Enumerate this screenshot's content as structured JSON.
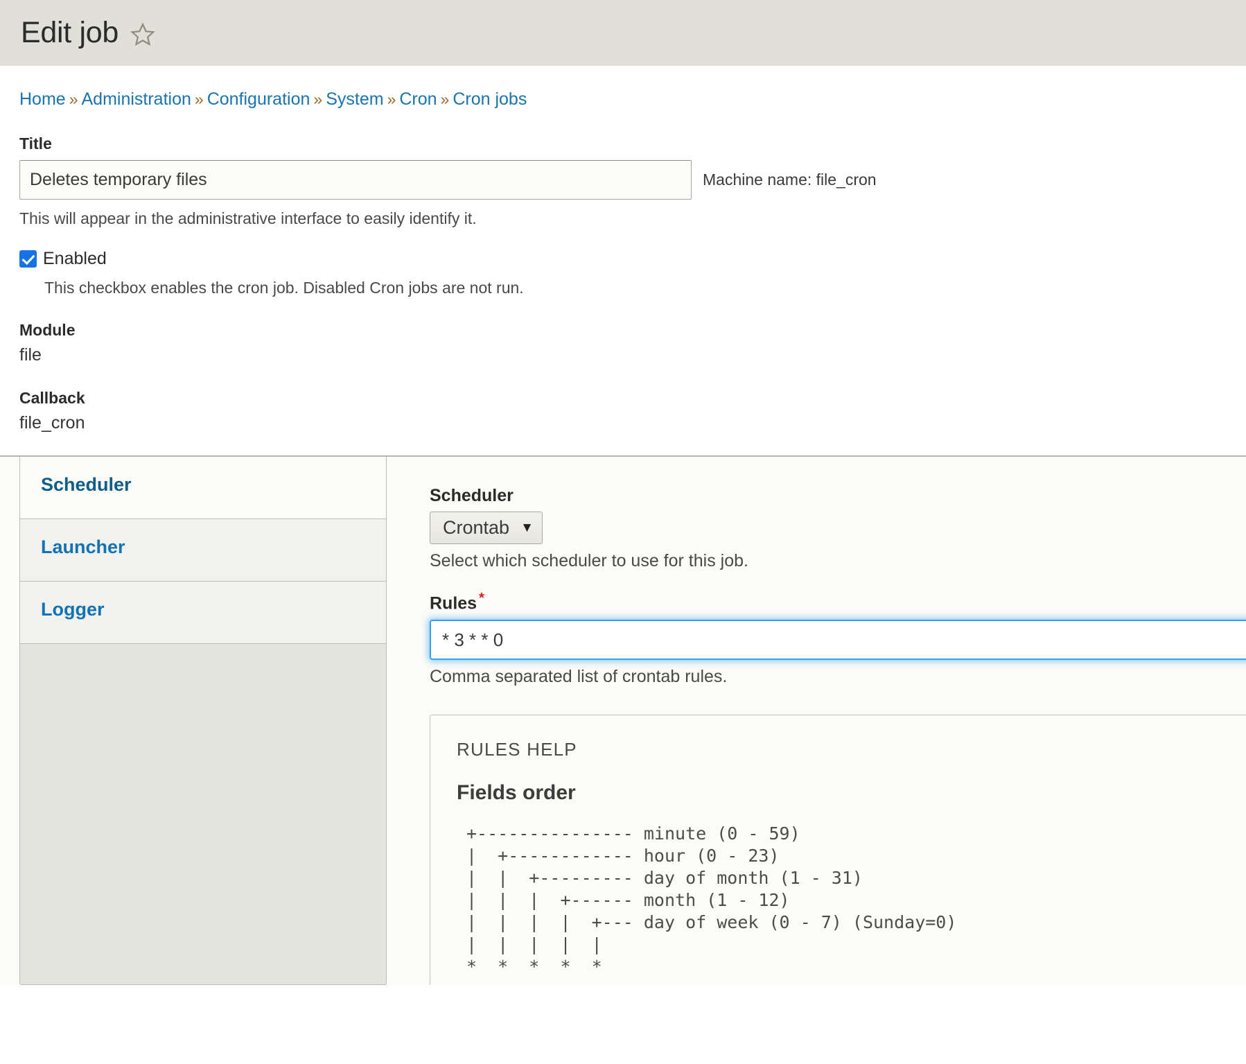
{
  "header": {
    "title": "Edit job",
    "star_icon": "star-outline-icon"
  },
  "breadcrumb": {
    "separator": "»",
    "items": [
      {
        "label": "Home"
      },
      {
        "label": "Administration"
      },
      {
        "label": "Configuration"
      },
      {
        "label": "System"
      },
      {
        "label": "Cron"
      },
      {
        "label": "Cron jobs"
      }
    ]
  },
  "form": {
    "title_field": {
      "label": "Title",
      "value": "Deletes temporary files",
      "placeholder": "",
      "machine_name": "Machine name: file_cron",
      "description": "This will appear in the administrative interface to easily identify it."
    },
    "enabled_field": {
      "label": "Enabled",
      "checked": true,
      "description": "This checkbox enables the cron job. Disabled Cron jobs are not run."
    },
    "module_field": {
      "label": "Module",
      "value": "file"
    },
    "callback_field": {
      "label": "Callback",
      "value": "file_cron"
    }
  },
  "vertical_tabs": {
    "items": [
      {
        "label": "Scheduler",
        "active": true
      },
      {
        "label": "Launcher",
        "active": false
      },
      {
        "label": "Logger",
        "active": false
      }
    ]
  },
  "scheduler_pane": {
    "scheduler_select": {
      "label": "Scheduler",
      "value": "Crontab",
      "caret": "▼",
      "description": "Select which scheduler to use for this job.",
      "options": [
        "Crontab"
      ]
    },
    "rules_field": {
      "label": "Rules",
      "required_marker": "*",
      "value": "* 3 * * 0",
      "placeholder": "",
      "description": "Comma separated list of crontab rules."
    },
    "rules_help": {
      "title": "RULES HELP",
      "subtitle": "Fields order",
      "diagram": "+--------------- minute (0 - 59)\n|  +------------ hour (0 - 23)\n|  |  +--------- day of month (1 - 31)\n|  |  |  +------ month (1 - 12)\n|  |  |  |  +--- day of week (0 - 7) (Sunday=0)\n|  |  |  |  |\n*  *  *  *  *"
    }
  },
  "colors": {
    "header_bg": "#e0e0d8",
    "link_blue": "#1a74b0",
    "active_tab_blue": "#0e5e8a",
    "checkbox_blue": "#1673e6",
    "required_red": "#d72222",
    "focus_blue": "#2fa3f0"
  }
}
